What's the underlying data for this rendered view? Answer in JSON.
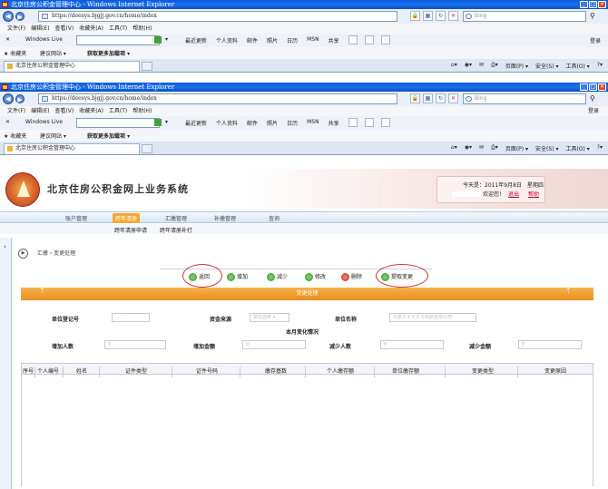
{
  "browser": {
    "title": "北京住房公积金管理中心 - Windows Internet Explorer",
    "url": "https://deesys.bjgjj.gov.cn/home/index",
    "search_placeholder": "Bing",
    "menus": [
      "文件(F)",
      "编辑(E)",
      "查看(V)",
      "收藏夹(A)",
      "工具(T)",
      "帮助(H)"
    ],
    "login_label": "登录",
    "windows_live": "Windows Live",
    "live_items": [
      "最近更新",
      "个人资料",
      "邮件",
      "照片",
      "日历",
      "MSN",
      "共享"
    ],
    "favorites": "收藏夹",
    "suggested_sites": "建议网站 ▾",
    "more_addons": "获取更多加载项 ▾",
    "tab_label": "北京住房公积金管理中心",
    "tab_tools": [
      "页面(P) ▾",
      "安全(S) ▾",
      "工具(O) ▾"
    ]
  },
  "header": {
    "system_title": "北京住房公积金网上业务系统",
    "date_text": "今天是：2011年9月8日　星期四",
    "welcome": "欢迎您！",
    "logout": "退出",
    "help": "帮助"
  },
  "nav": {
    "items": [
      "账户管理",
      "跨年清册",
      "汇缴管理",
      "补缴管理",
      "查询"
    ],
    "active_index": 1,
    "sub_items": [
      "跨年清册申请",
      "跨年清册补打"
    ]
  },
  "breadcrumb": {
    "root": "汇缴",
    "current": "变更处理"
  },
  "actions": {
    "back": "返回",
    "add": "增加",
    "reduce": "减少",
    "modify": "修改",
    "delete": "删除",
    "submit": "提取变更"
  },
  "panel_title": "变更处理",
  "form": {
    "unit_reg_no_label": "单位登记号",
    "unit_reg_no_value": "……",
    "fund_source_label": "资金来源",
    "fund_source_value": "单位自筹",
    "unit_name_label": "单位名称",
    "unit_name_value": "北京ＸＸＸＸＸ科技有限公司",
    "month_change_title": "本月变化情况",
    "add_people_label": "增加人数",
    "add_people_value": "0",
    "add_amount_label": "增加金额",
    "add_amount_value": "0",
    "reduce_people_label": "减少人数",
    "reduce_people_value": "0",
    "reduce_amount_label": "减少金额",
    "reduce_amount_value": "0"
  },
  "table": {
    "columns": [
      "序号",
      "个人编号",
      "姓名",
      "证件类型",
      "证件号码",
      "缴存基数",
      "个人缴存额",
      "单位缴存额",
      "变更类型",
      "变更原因"
    ]
  }
}
